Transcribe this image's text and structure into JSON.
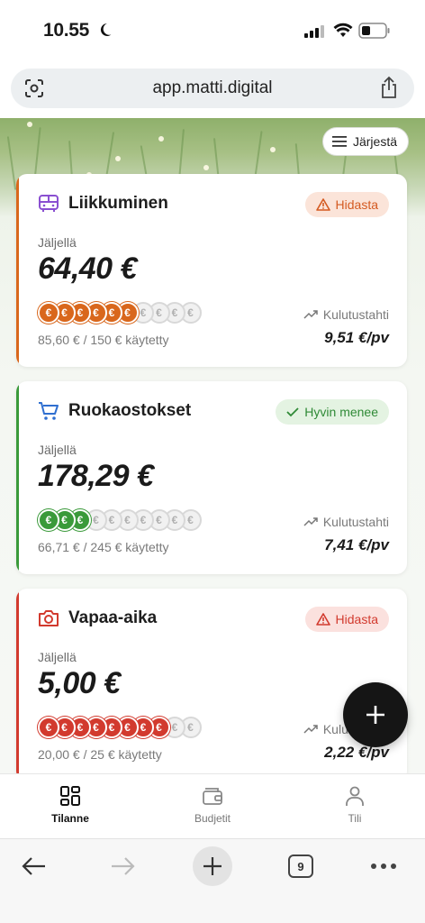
{
  "status_bar": {
    "time": "10.55"
  },
  "browser": {
    "url": "app.matti.digital",
    "tab_count": "9"
  },
  "sort_button": {
    "label": "Järjestä"
  },
  "cards": [
    {
      "title": "Liikkuminen",
      "icon": "bus-icon",
      "status": "Hidasta",
      "status_kind": "warning",
      "remaining_label": "Jäljellä",
      "remaining": "64,40 €",
      "spent_text": "85,60 € / 150 € käytetty",
      "rate_label": "Kulutustahti",
      "rate": "9,51 €/pv",
      "coins_filled": 6,
      "coins_total": 10,
      "accent_color": "#d9671c"
    },
    {
      "title": "Ruokaostokset",
      "icon": "cart-icon",
      "status": "Hyvin menee",
      "status_kind": "good",
      "remaining_label": "Jäljellä",
      "remaining": "178,29 €",
      "spent_text": "66,71 € / 245 € käytetty",
      "rate_label": "Kulutustahti",
      "rate": "7,41 €/pv",
      "coins_filled": 3,
      "coins_total": 10,
      "accent_color": "#3a9a3a"
    },
    {
      "title": "Vapaa-aika",
      "icon": "camera-icon",
      "status": "Hidasta",
      "status_kind": "danger",
      "remaining_label": "Jäljellä",
      "remaining": "5,00 €",
      "spent_text": "20,00 € / 25 € käytetty",
      "rate_label": "Kulutustahti",
      "rate": "2,22 €/pv",
      "coins_filled": 8,
      "coins_total": 10,
      "accent_color": "#d23a2e"
    }
  ],
  "coin_symbol": "€",
  "bottom_nav": [
    {
      "label": "Tilanne",
      "icon": "dashboard-icon",
      "active": true
    },
    {
      "label": "Budjetit",
      "icon": "wallet-icon",
      "active": false
    },
    {
      "label": "Tili",
      "icon": "person-icon",
      "active": false
    }
  ]
}
